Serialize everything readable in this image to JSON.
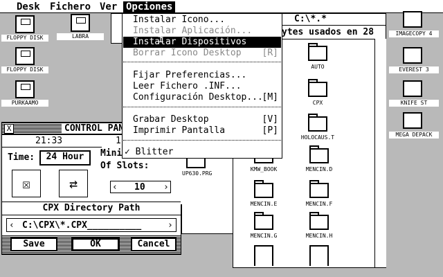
{
  "menubar": {
    "items": [
      {
        "label": "Desk"
      },
      {
        "label": "Fichero"
      },
      {
        "label": "Ver"
      },
      {
        "label": "Opciones"
      }
    ]
  },
  "dropdown": {
    "items": [
      {
        "label": "Instalar Icono...",
        "shortcut": ""
      },
      {
        "label": "Instalar Aplicación...",
        "shortcut": ""
      },
      {
        "label": "Instalar Dispositivos",
        "shortcut": ""
      },
      {
        "label": "Borrar Icono Desktop",
        "shortcut": "[R]"
      },
      {
        "label": "Fijar Preferencias...",
        "shortcut": ""
      },
      {
        "label": "Leer Fichero .INF...",
        "shortcut": ""
      },
      {
        "label": "Configuración Desktop...",
        "shortcut": "[M]"
      },
      {
        "label": "Grabar Desktop",
        "shortcut": "[V]"
      },
      {
        "label": "Imprimir Pantalla",
        "shortcut": "[P]"
      },
      {
        "label": "Blitter",
        "check": "✓"
      }
    ]
  },
  "desktop_icons": [
    {
      "label": "FLOPPY DISK",
      "letter": "A"
    },
    {
      "label": "FLOPPY DISK",
      "letter": "B"
    },
    {
      "label": "LABRA"
    },
    {
      "label": "PURKAAMO"
    }
  ],
  "right_icons": [
    {
      "label": "IMAGECOPY 4"
    },
    {
      "label": "EVEREST 3"
    },
    {
      "label": "KNIFE ST"
    },
    {
      "label": "MEGA DEPACK"
    }
  ],
  "dirwindow": {
    "title": "C:\\*.*",
    "info": "ytes usados en 28",
    "folders": [
      "AUTO",
      "CPX",
      "HOLOCAUS.T",
      "KMW_BOOK",
      "MENCIN.D",
      "MENCIN.E",
      "MENCIN.F",
      "MENCIN.G",
      "MENCIN.H"
    ]
  },
  "behind_window": {
    "file_label": "UP630.PRG"
  },
  "control_panel": {
    "title": "CONTROL PAN",
    "time_display": "21:33",
    "time_right": "1",
    "time_label": "Time:",
    "time_mode": "24 Hour",
    "slots_label_1": "Mini",
    "slots_label_2": "Of Slots:",
    "slots_value": "10",
    "dir_label": "CPX Directory Path",
    "dir_value": "C:\\CPX\\*.CPX__________",
    "save": "Save",
    "ok": "OK",
    "cancel": "Cancel"
  }
}
